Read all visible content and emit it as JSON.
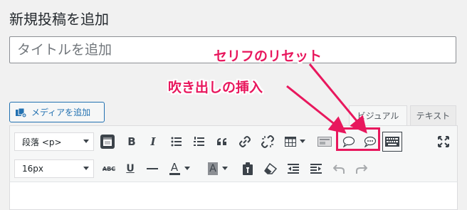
{
  "page": {
    "title": "新規投稿を追加"
  },
  "title_field": {
    "placeholder": "タイトルを追加"
  },
  "media": {
    "label": "メディアを追加",
    "icon": "media-add-icon"
  },
  "tabs": [
    {
      "label": "ビジュアル"
    },
    {
      "label": "テキスト"
    }
  ],
  "toolbar": {
    "format_select": {
      "value": "段落 <p>"
    },
    "fontsize_select": {
      "value": "16px"
    },
    "row1_icons": [
      "toolbar-toggle-icon",
      "bold-icon",
      "italic-icon",
      "bullet-list-icon",
      "numbered-list-icon",
      "blockquote-icon",
      "link-icon",
      "unlink-icon",
      "table-icon",
      "embed-icon",
      "speech-bubble-icon",
      "speech-bubble-dots-icon",
      "keyboard-icon",
      "fullscreen-icon"
    ],
    "row2_icons": [
      "strikethrough-icon",
      "underline-icon",
      "horizontal-line-icon",
      "text-color-icon",
      "background-color-icon",
      "paste-text-icon",
      "clear-formatting-icon",
      "outdent-icon",
      "indent-icon",
      "undo-icon",
      "redo-icon"
    ],
    "strike_text": "ABC",
    "bold_text": "B",
    "italic_text": "I",
    "underline_text": "U",
    "color_text": "A",
    "bgcolor_text": "A"
  },
  "annotations": {
    "label_1": "吹き出しの挿入",
    "label_2": "セリフのリセット",
    "color": "#e8175d"
  }
}
